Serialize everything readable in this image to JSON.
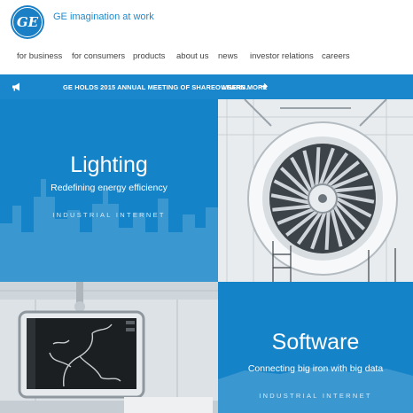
{
  "header": {
    "logo_text": "GE",
    "tagline": "GE imagination at work"
  },
  "nav": [
    {
      "label": "for business"
    },
    {
      "label": "for consumers"
    },
    {
      "label": "products"
    },
    {
      "label": "about us"
    },
    {
      "label": "news"
    },
    {
      "label": "investor relations"
    },
    {
      "label": "careers"
    }
  ],
  "announcement": {
    "text": "GE HOLDS 2015 ANNUAL MEETING OF SHAREOWNERS.",
    "link_label": "LEARN MORE",
    "icon": "megaphone-icon"
  },
  "tiles": {
    "lighting": {
      "title": "Lighting",
      "subtitle": "Redefining energy efficiency",
      "tag": "INDUSTRIAL INTERNET"
    },
    "software": {
      "title": "Software",
      "subtitle": "Connecting big iron with big data",
      "tag": "INDUSTRIAL INTERNET"
    }
  },
  "colors": {
    "brand_blue": "#1a86cb",
    "tile_blue": "#1583c7",
    "link_blue": "#1a8bd0"
  }
}
